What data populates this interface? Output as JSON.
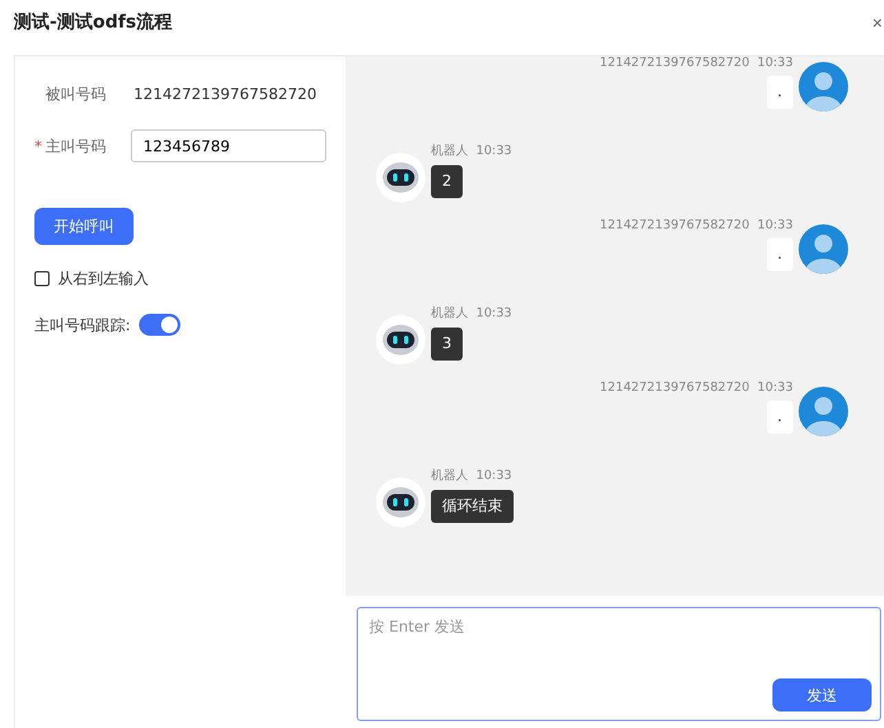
{
  "window": {
    "title": "测试-测试odfs流程",
    "close": "×"
  },
  "form": {
    "callee_label": "被叫号码",
    "callee_value": "1214272139767582720",
    "caller_label": "主叫号码",
    "caller_required_mark": "*",
    "caller_value": "123456789",
    "start_button": "开始呼叫",
    "rtl": {
      "label": "从右到左输入",
      "checked": false
    },
    "tracking": {
      "label": "主叫号码跟踪:",
      "on": true
    }
  },
  "messages": [
    {
      "kind": "user",
      "sender": "1214272139767582720",
      "time": "10:33",
      "text": "."
    },
    {
      "kind": "bot",
      "sender": "机器人",
      "time": "10:33",
      "text": "2"
    },
    {
      "kind": "user",
      "sender": "1214272139767582720",
      "time": "10:33",
      "text": "."
    },
    {
      "kind": "bot",
      "sender": "机器人",
      "time": "10:33",
      "text": "3"
    },
    {
      "kind": "user",
      "sender": "1214272139767582720",
      "time": "10:33",
      "text": "."
    },
    {
      "kind": "bot",
      "sender": "机器人",
      "time": "10:33",
      "text": "循环结束"
    }
  ],
  "composer": {
    "placeholder": "按 Enter 发送",
    "send_button": "发送"
  }
}
